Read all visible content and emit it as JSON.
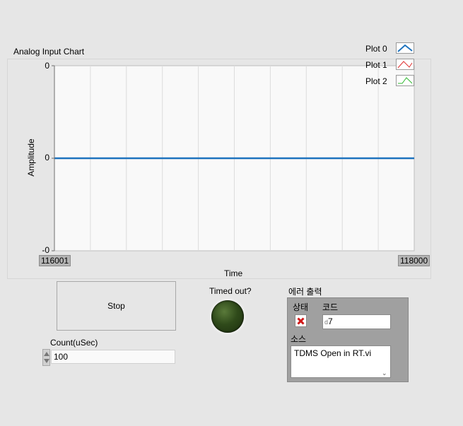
{
  "chart": {
    "title": "Analog Input Chart",
    "ylabel": "Amplitude",
    "xlabel": "Time",
    "y_ticks": [
      "0",
      "0",
      "-0"
    ],
    "x_start": "116001",
    "x_end": "118000",
    "legend": [
      {
        "name": "Plot 0",
        "color": "#1e73be"
      },
      {
        "name": "Plot 1",
        "color": "#e03030"
      },
      {
        "name": "Plot 2",
        "color": "#2db82d"
      }
    ]
  },
  "chart_data": {
    "type": "line",
    "title": "Analog Input Chart",
    "xlabel": "Time",
    "ylabel": "Amplitude",
    "xlim": [
      116001,
      118000
    ],
    "ylim": [
      -0.0,
      0.0
    ],
    "grid": true,
    "legend_position": "top-right",
    "series": [
      {
        "name": "Plot 0",
        "color": "#1e73be",
        "x": [
          116001,
          118000
        ],
        "y": [
          0,
          0
        ]
      },
      {
        "name": "Plot 1",
        "color": "#e03030",
        "x": [],
        "y": []
      },
      {
        "name": "Plot 2",
        "color": "#2db82d",
        "x": [],
        "y": []
      }
    ]
  },
  "controls": {
    "stop_label": "Stop",
    "timed_out_label": "Timed out?",
    "count_label": "Count(uSec)",
    "count_value": "100"
  },
  "error_out": {
    "title": "에러 출력",
    "status_label": "상태",
    "code_label": "코드",
    "code_prefix": "d",
    "code_value": "7",
    "source_label": "소스",
    "source_value": "TDMS Open in RT.vi"
  },
  "icons": {
    "status": "error-x-icon",
    "spinner": "increment-decrement-icon",
    "scroll": "chevron-down-icon"
  }
}
